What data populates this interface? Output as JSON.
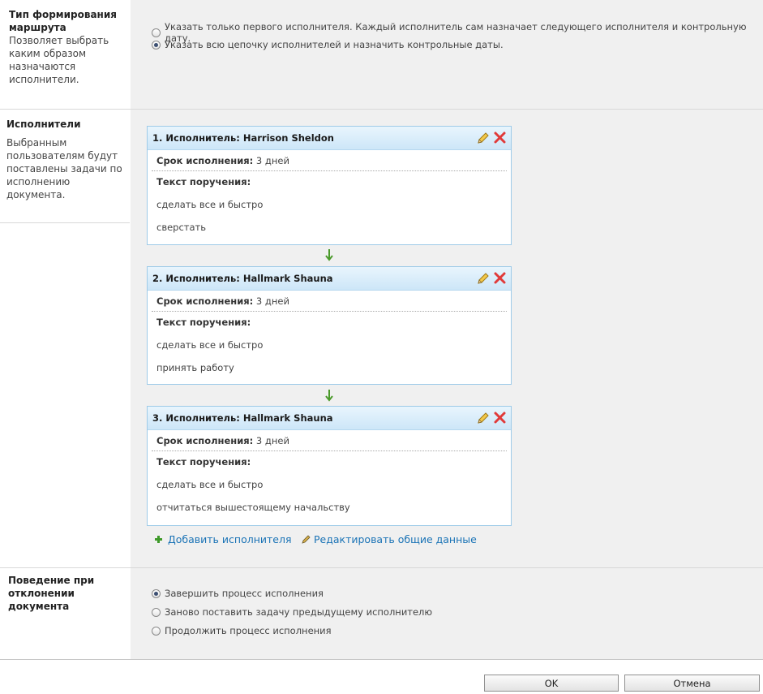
{
  "route_type": {
    "title": "Тип формирования маршрута",
    "description": "Позволяет выбрать каким образом назначаются исполнители.",
    "options": [
      {
        "label": "Указать только первого исполнителя. Каждый исполнитель сам назначает следующего исполнителя и контрольную дату.",
        "selected": false
      },
      {
        "label": "Указать всю цепочку исполнителей и назначить контрольные даты.",
        "selected": true
      }
    ]
  },
  "executors": {
    "title": "Исполнители",
    "description": "Выбранным пользователям будут поставлены задачи по исполнению документа.",
    "cards": [
      {
        "title": "1. Исполнитель: Harrison Sheldon",
        "deadline_label": "Срок исполнения:",
        "deadline_value": "3 дней",
        "text_label": "Текст поручения:",
        "lines": [
          "сделать все и быстро",
          "сверстать"
        ]
      },
      {
        "title": "2. Исполнитель: Hallmark Shauna",
        "deadline_label": "Срок исполнения:",
        "deadline_value": "3 дней",
        "text_label": "Текст поручения:",
        "lines": [
          "сделать все и быстро",
          "принять работу"
        ]
      },
      {
        "title": "3. Исполнитель: Hallmark Shauna",
        "deadline_label": "Срок исполнения:",
        "deadline_value": "3 дней",
        "text_label": "Текст поручения:",
        "lines": [
          "сделать все и быстро",
          "отчитаться вышестоящему начальству"
        ]
      }
    ],
    "add_link": "Добавить исполнителя",
    "edit_link": "Редактировать общие данные",
    "icons": {
      "edit": "pencil-icon",
      "delete": "close-icon",
      "flow": "arrow-down-icon",
      "add": "plus-icon"
    }
  },
  "rejection": {
    "title": "Поведение при отклонении документа",
    "options": [
      {
        "label": "Завершить процесс исполнения",
        "selected": true
      },
      {
        "label": "Заново поставить задачу предыдущему исполнителю",
        "selected": false
      },
      {
        "label": "Продолжить процесс исполнения",
        "selected": false
      }
    ]
  },
  "buttons": {
    "ok": "OK",
    "cancel": "Отмена"
  },
  "colors": {
    "card_border": "#9ecbe8",
    "header_gradient": "#cde6f8",
    "link": "#1a73b6",
    "delete": "#e03a3a",
    "panel_bg": "#f0f0f0"
  }
}
